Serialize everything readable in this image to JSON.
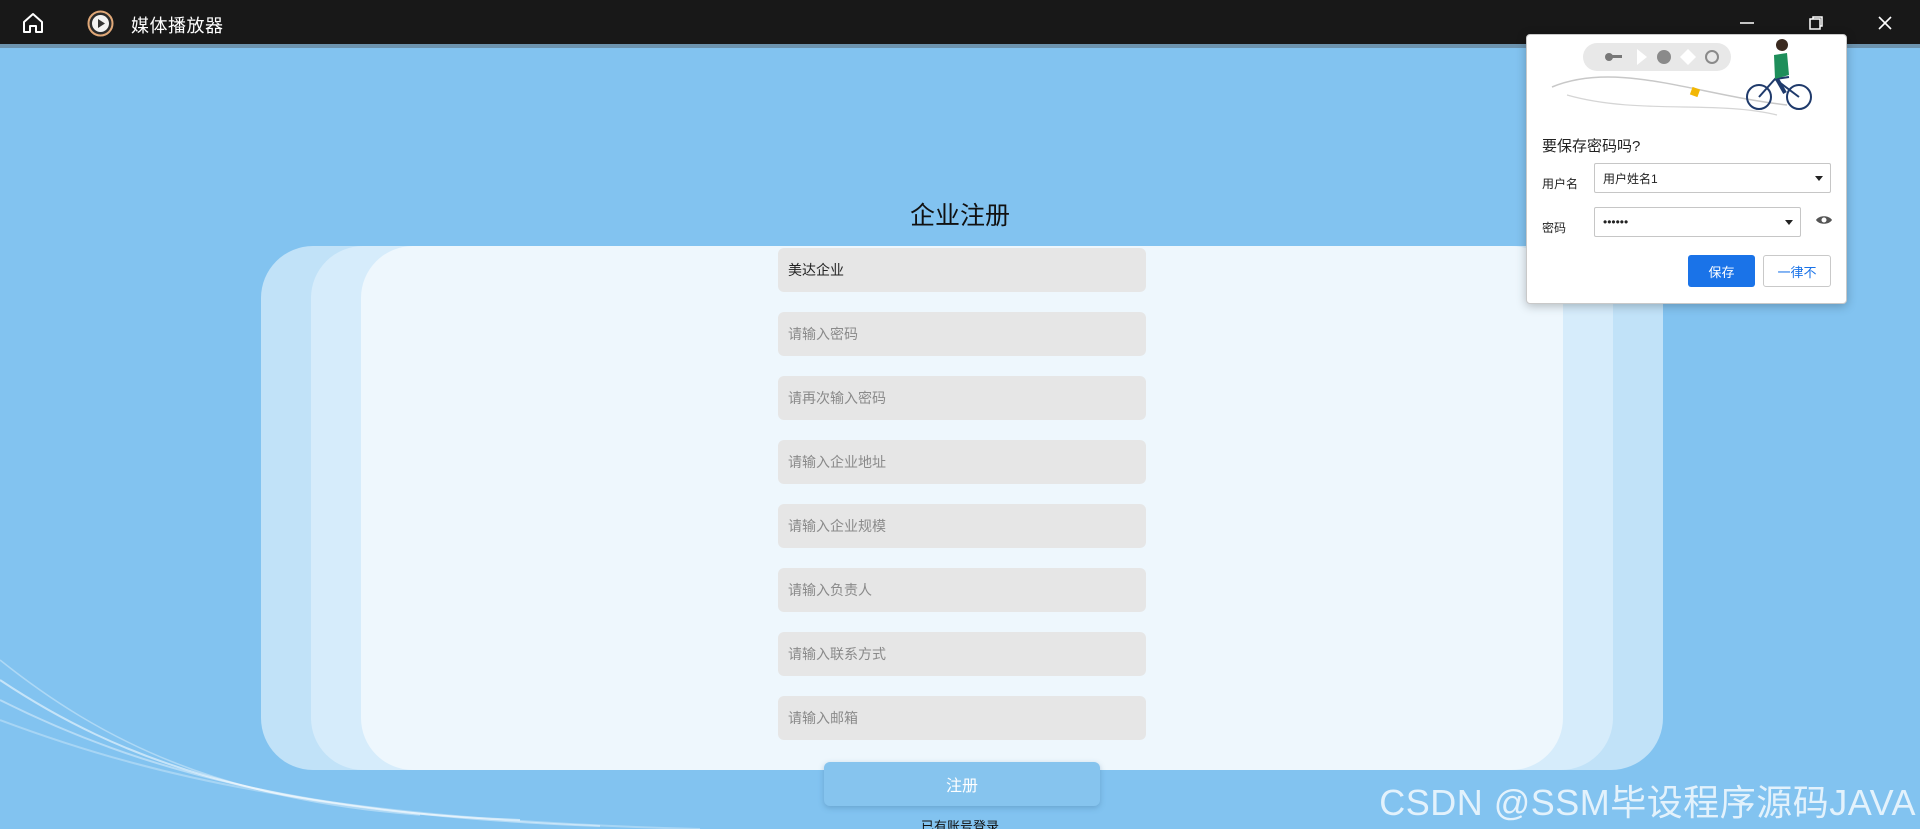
{
  "titlebar": {
    "app_title": "媒体播放器",
    "home_icon": "home-icon",
    "app_icon": "play-circle-icon",
    "controls": [
      "minimize-icon",
      "restore-icon",
      "close-icon"
    ]
  },
  "page": {
    "heading": "企业注册",
    "fields": [
      {
        "name": "company-name-input",
        "value": "美达企业",
        "placeholder": ""
      },
      {
        "name": "password-input",
        "value": "",
        "placeholder": "请输入密码"
      },
      {
        "name": "confirm-password-input",
        "value": "",
        "placeholder": "请再次输入密码"
      },
      {
        "name": "company-address-input",
        "value": "",
        "placeholder": "请输入企业地址"
      },
      {
        "name": "company-size-input",
        "value": "",
        "placeholder": "请输入企业规模"
      },
      {
        "name": "contact-person-input",
        "value": "",
        "placeholder": "请输入负责人"
      },
      {
        "name": "contact-method-input",
        "value": "",
        "placeholder": "请输入联系方式"
      },
      {
        "name": "email-input",
        "value": "",
        "placeholder": "请输入邮箱"
      }
    ],
    "register_label": "注册",
    "login_link": "已有账号登录"
  },
  "save_password_popup": {
    "title": "要保存密码吗?",
    "username_label": "用户名",
    "username_value": "用户姓名1",
    "password_label": "密码",
    "password_value": "••••••",
    "save_label": "保存",
    "never_label": "一律不"
  },
  "watermark": "CSDN @SSM毕设程序源码JAVA",
  "colors": {
    "background": "#82c3f0",
    "titlebar": "#181818",
    "accent_blue": "#1a73e8",
    "register_button": "#86c4ee"
  }
}
